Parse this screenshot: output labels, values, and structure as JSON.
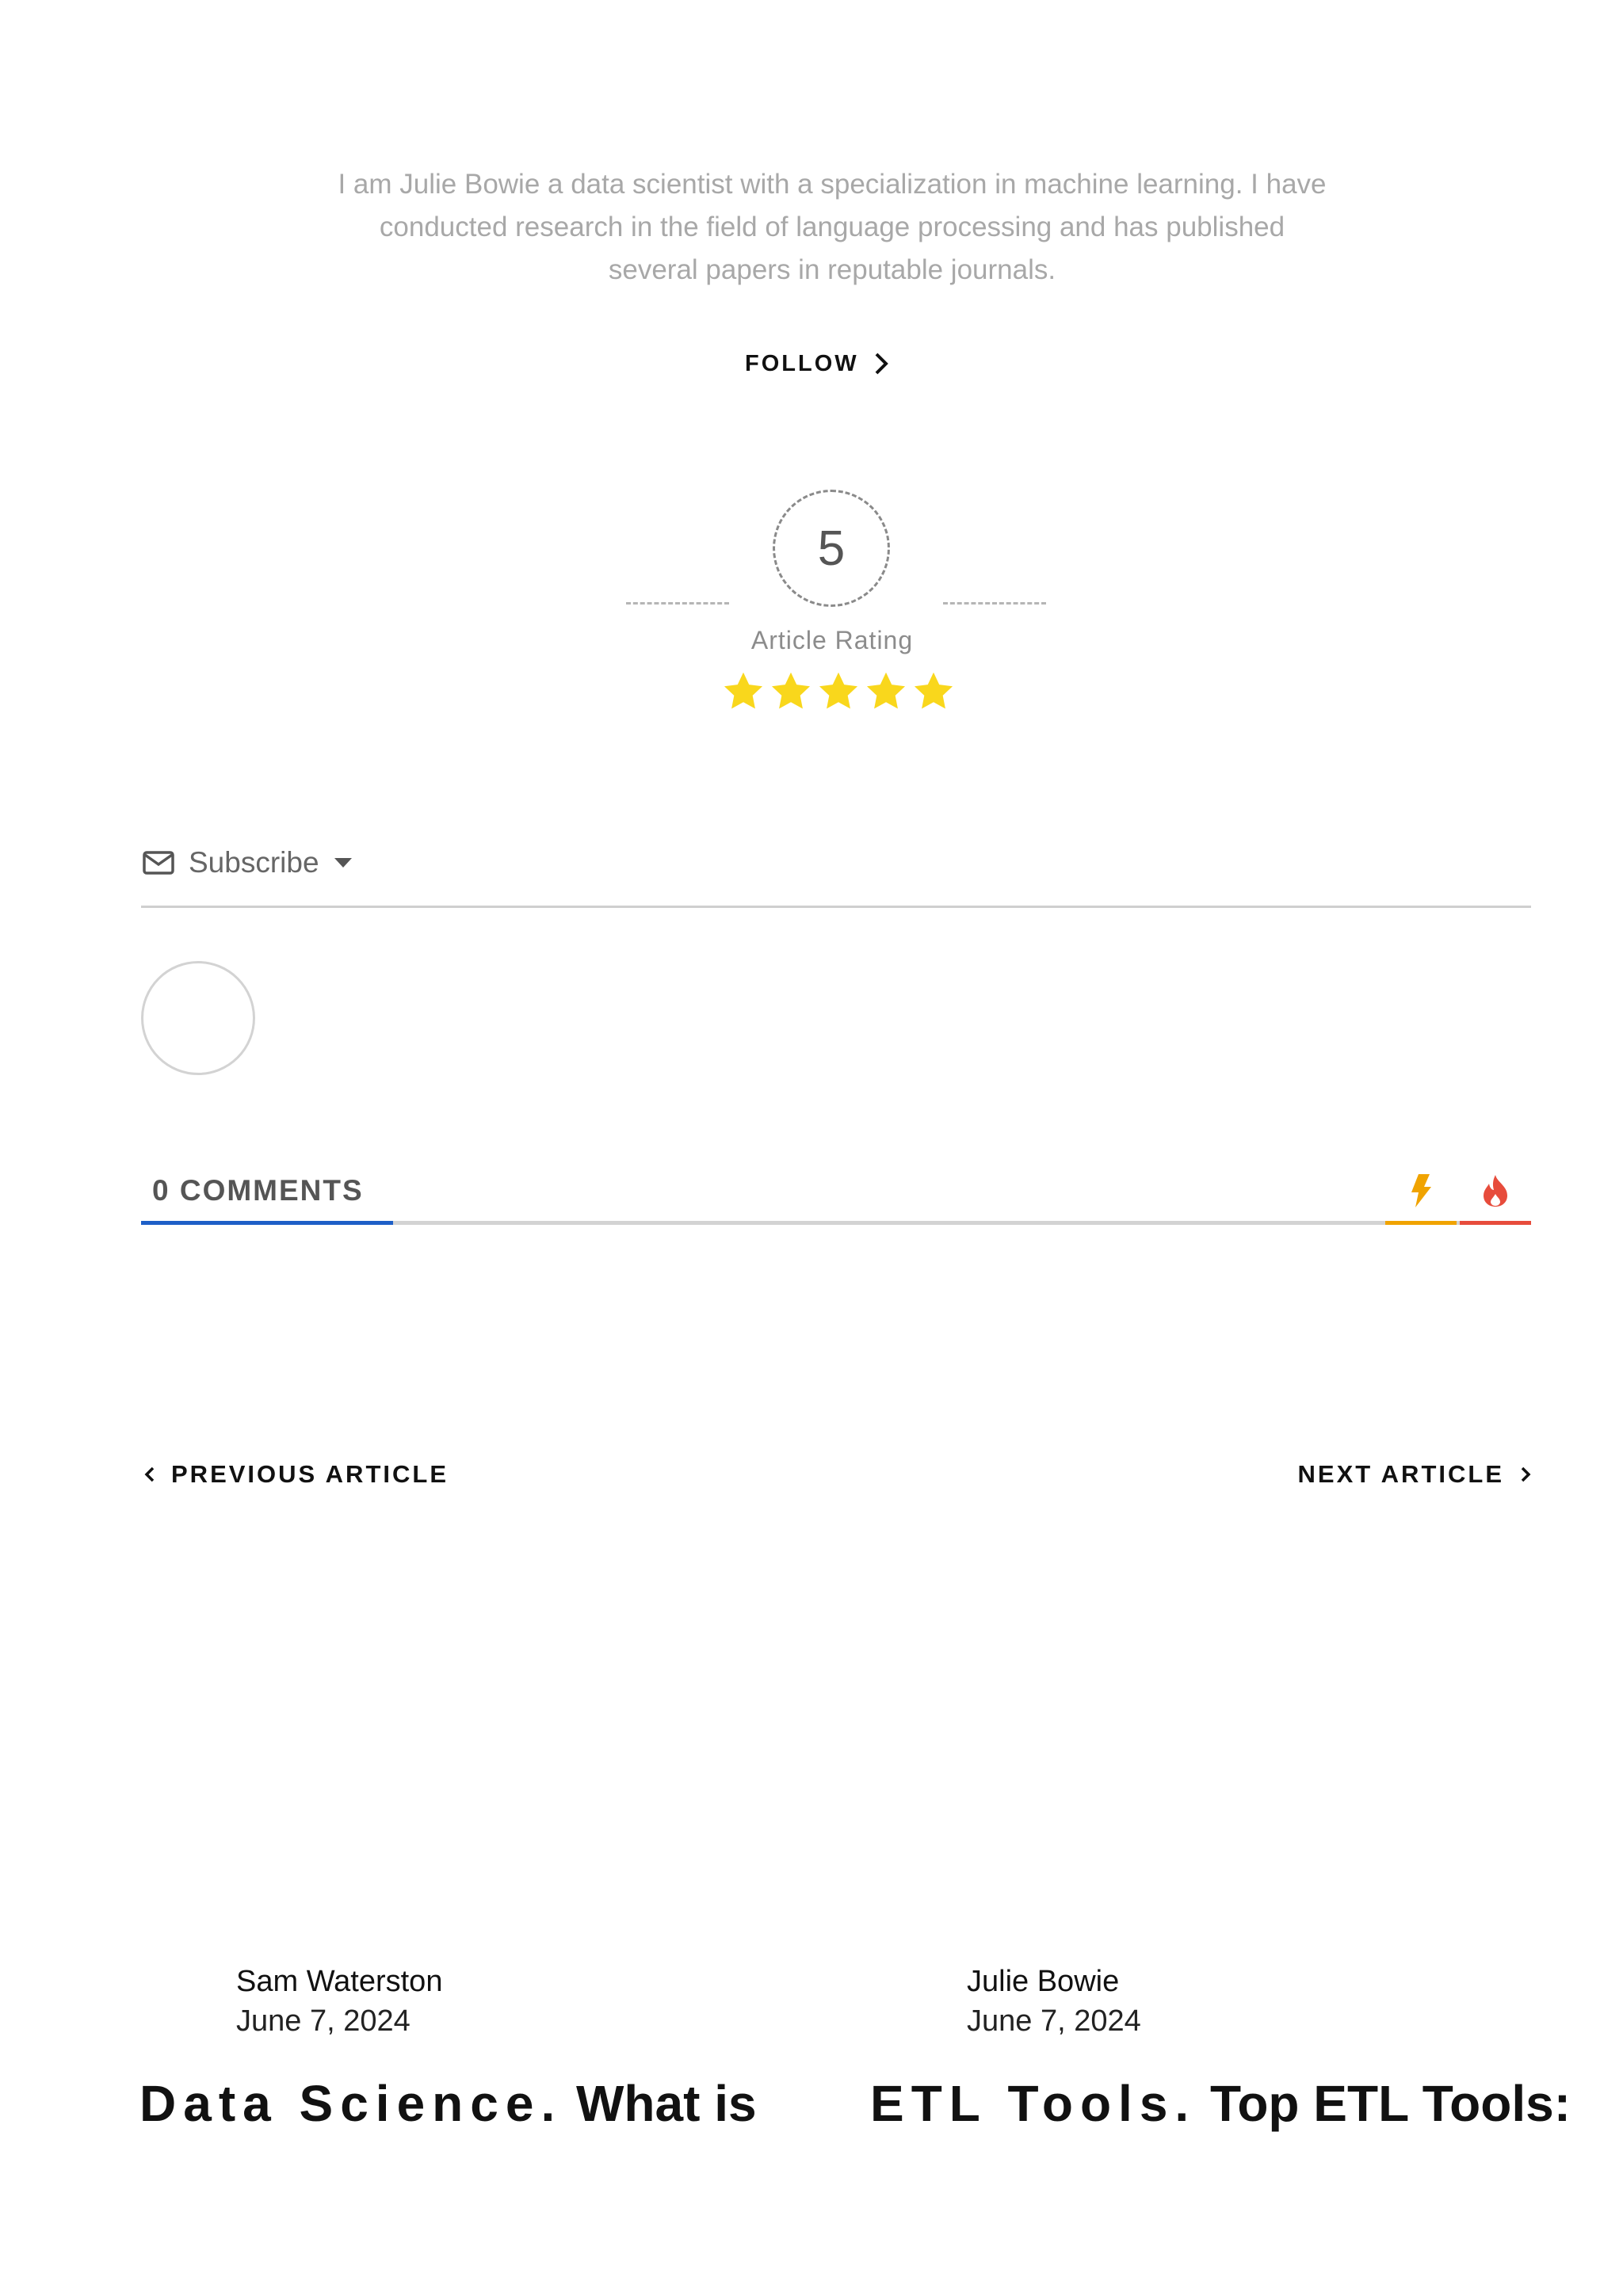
{
  "author_box": {
    "bio": "I am Julie Bowie a data scientist with a specialization in machine learning. I have conducted research in the field of language processing and has published several papers in reputable journals.",
    "follow_label": "FOLLOW"
  },
  "rating": {
    "value": "5",
    "label": "Article Rating",
    "stars_filled": 5,
    "stars_total": 5,
    "star_color": "#f9d71c"
  },
  "subscribe": {
    "label": "Subscribe"
  },
  "comments": {
    "count_label": "0 COMMENTS",
    "accent_color": "#1e5fc7"
  },
  "navigation": {
    "previous_label": "PREVIOUS ARTICLE",
    "next_label": "NEXT ARTICLE"
  },
  "articles": [
    {
      "author": "Sam Waterston",
      "date": "June 7, 2024",
      "title_lead": "Data Science.",
      "title_rest": "What is"
    },
    {
      "author": "Julie Bowie",
      "date": "June 7, 2024",
      "title_lead": "ETL Tools.",
      "title_rest": "Top ETL Tools:"
    }
  ]
}
